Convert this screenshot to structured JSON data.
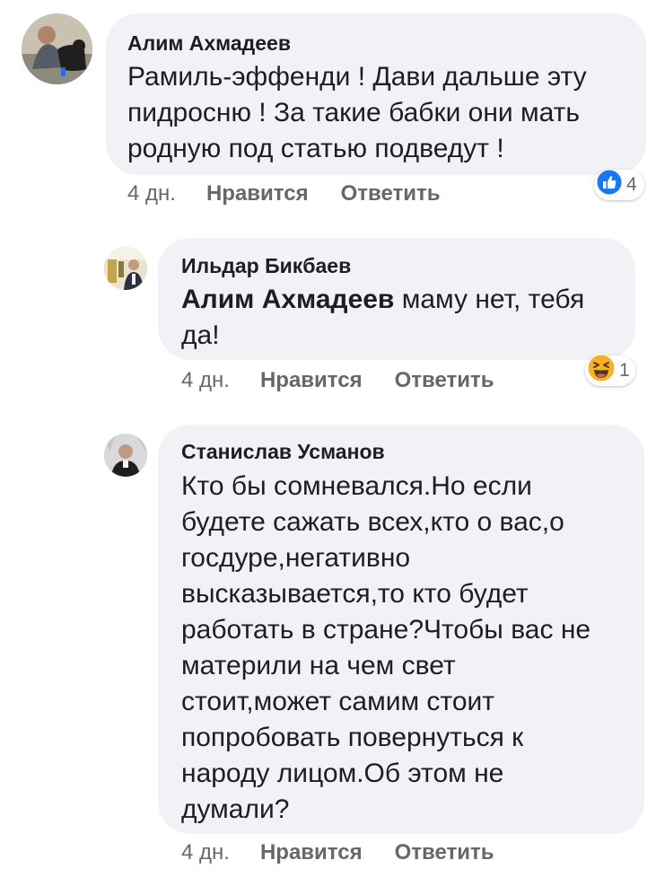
{
  "comments": [
    {
      "author": "Алим Ахмадеев",
      "text_lines": [
        "Рамиль-эффенди ! Дави дальше эту",
        "пидросню ! За такие бабки они мать",
        "родную под статью подведут !"
      ],
      "time": "4 дн.",
      "like_label": "Нравится",
      "reply_label": "Ответить",
      "reaction": {
        "icon": "thumbs-up-icon",
        "color": "#1877f2",
        "count": "4"
      }
    },
    {
      "author": "Ильдар Бикбаев",
      "mention": "Алим Ахмадеев",
      "text_line1": " маму нет, тебя",
      "text_line2": "да!",
      "time": "4 дн.",
      "like_label": "Нравится",
      "reply_label": "Ответить",
      "reaction": {
        "icon": "laughing-emoji-icon",
        "color": "#f7b125",
        "count": "1"
      }
    },
    {
      "author": "Станислав Усманов",
      "text_lines": [
        "Кто бы сомневался.Но если",
        "будете сажать всех,кто о вас,о",
        "госдуре,негативно",
        "высказывается,то кто будет",
        "работать в стране?Чтобы вас не",
        "материли на чем свет",
        "стоит,может самим стоит",
        "попробовать повернуться к",
        "народу лицом.Об этом не",
        "думали?"
      ],
      "time": "4 дн.",
      "like_label": "Нравится",
      "reply_label": "Ответить"
    }
  ]
}
